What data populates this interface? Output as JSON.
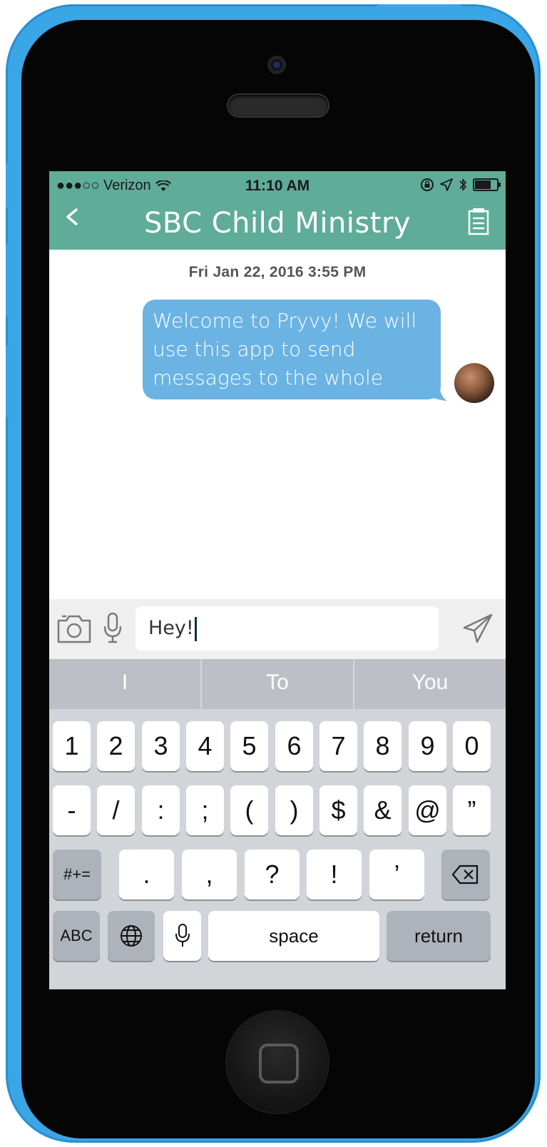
{
  "status_bar": {
    "carrier": "●●●○○ Verizon",
    "time": "11:10 AM"
  },
  "header": {
    "title": "SBC Child Ministry"
  },
  "conversation": {
    "timestamp": "Fri Jan 22, 2016 3:55 PM",
    "message": "Welcome to Pryvy! We will use this app to send messages to the whole group."
  },
  "composer": {
    "text": "Hey!"
  },
  "keyboard": {
    "suggestions": [
      "I",
      "To",
      "You"
    ],
    "row1": [
      "1",
      "2",
      "3",
      "4",
      "5",
      "6",
      "7",
      "8",
      "9",
      "0"
    ],
    "row2": [
      "-",
      "/",
      ":",
      ";",
      "(",
      ")",
      "$",
      "&",
      "@",
      "”"
    ],
    "row3": [
      ".",
      ",",
      "?",
      "!",
      "’"
    ],
    "mode_key": "#+=",
    "abc_key": "ABC",
    "space_key": "space",
    "return_key": "return"
  },
  "icons": {
    "back": "chevron-left-icon",
    "notes": "notes-icon",
    "camera": "camera-icon",
    "mic": "microphone-icon",
    "send": "paper-plane-icon",
    "backspace": "backspace-icon",
    "globe": "globe-icon"
  },
  "colors": {
    "header": "#5fac98",
    "bubble": "#6bb3e3",
    "phone_shell": "#3aa6e6",
    "keyboard": "#d1d4d9"
  }
}
